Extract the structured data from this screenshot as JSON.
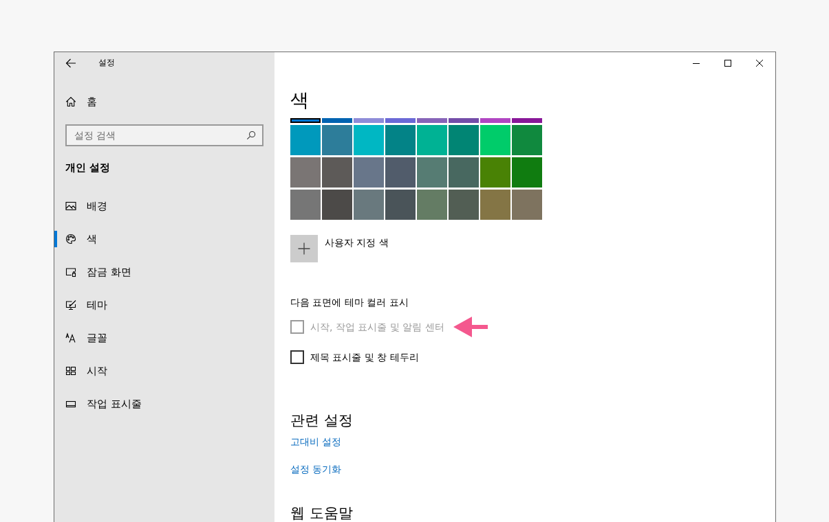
{
  "window": {
    "title": "설정"
  },
  "sidebar": {
    "home": "홈",
    "search": {
      "placeholder": "설정 검색"
    },
    "section": "개인 설정",
    "items": [
      {
        "label": "배경",
        "selected": false
      },
      {
        "label": "색",
        "selected": true
      },
      {
        "label": "잠금 화면",
        "selected": false
      },
      {
        "label": "테마",
        "selected": false
      },
      {
        "label": "글꼴",
        "selected": false
      },
      {
        "label": "시작",
        "selected": false
      },
      {
        "label": "작업 표시줄",
        "selected": false
      }
    ]
  },
  "content": {
    "title": "색",
    "swatch_rows": [
      {
        "clipped": true,
        "swatches": [
          {
            "color": "#0078d7",
            "selected": true
          },
          {
            "color": "#0063b1",
            "selected": false
          },
          {
            "color": "#8e8cd8",
            "selected": false
          },
          {
            "color": "#6b69d6",
            "selected": false
          },
          {
            "color": "#8764b8",
            "selected": false
          },
          {
            "color": "#744da9",
            "selected": false
          },
          {
            "color": "#b146c2",
            "selected": false
          },
          {
            "color": "#881798",
            "selected": false
          }
        ]
      },
      {
        "clipped": false,
        "swatches": [
          {
            "color": "#0099bc",
            "selected": false
          },
          {
            "color": "#2d7d9a",
            "selected": false
          },
          {
            "color": "#00b7c3",
            "selected": false
          },
          {
            "color": "#038387",
            "selected": false
          },
          {
            "color": "#00b294",
            "selected": false
          },
          {
            "color": "#018574",
            "selected": false
          },
          {
            "color": "#00cc6a",
            "selected": false
          },
          {
            "color": "#10893e",
            "selected": false
          }
        ]
      },
      {
        "clipped": false,
        "swatches": [
          {
            "color": "#7a7574",
            "selected": false
          },
          {
            "color": "#5d5a58",
            "selected": false
          },
          {
            "color": "#68768a",
            "selected": false
          },
          {
            "color": "#515c6b",
            "selected": false
          },
          {
            "color": "#567c73",
            "selected": false
          },
          {
            "color": "#486860",
            "selected": false
          },
          {
            "color": "#498205",
            "selected": false
          },
          {
            "color": "#107c10",
            "selected": false
          }
        ]
      },
      {
        "clipped": false,
        "swatches": [
          {
            "color": "#767676",
            "selected": false
          },
          {
            "color": "#4c4a48",
            "selected": false
          },
          {
            "color": "#69797e",
            "selected": false
          },
          {
            "color": "#4a5459",
            "selected": false
          },
          {
            "color": "#647c64",
            "selected": false
          },
          {
            "color": "#525e54",
            "selected": false
          },
          {
            "color": "#847545",
            "selected": false
          },
          {
            "color": "#7e735f",
            "selected": false
          }
        ]
      }
    ],
    "custom_color": {
      "label": "사용자 지정 색"
    },
    "theme_color": {
      "heading": "다음 표면에 테마 컬러 표시",
      "options": [
        {
          "label": "시작, 작업 표시줄 및 알림 센터",
          "checked": false,
          "disabled": true
        },
        {
          "label": "제목 표시줄 및 창 테두리",
          "checked": false,
          "disabled": false
        }
      ]
    },
    "related_settings": {
      "heading": "관련 설정",
      "links": [
        "고대비 설정",
        "설정 동기화"
      ]
    },
    "web_help": {
      "heading": "웹 도움말"
    }
  }
}
